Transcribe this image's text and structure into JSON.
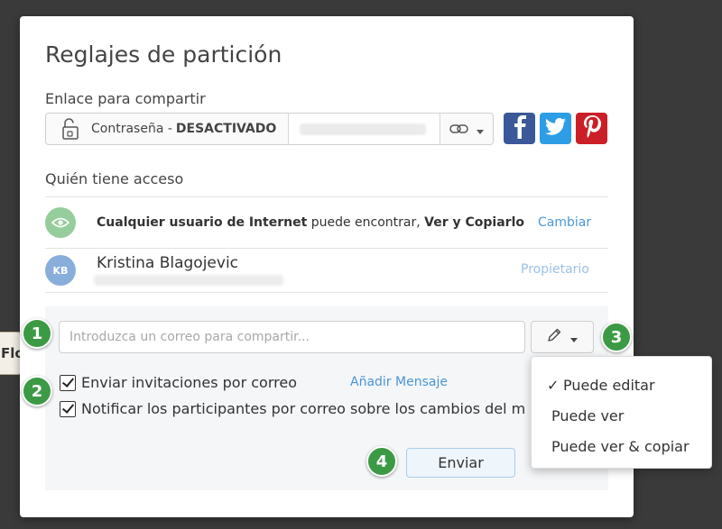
{
  "background": {
    "behind_tab_label": "Flo"
  },
  "dialog": {
    "title": "Reglajes de partición",
    "share_link": {
      "label": "Enlace para compartir",
      "password_label": "Contraseña -",
      "password_state": "DESACTIVADO",
      "url_value": "",
      "link_options_icon": "link-icon"
    },
    "social": [
      {
        "name": "facebook-icon",
        "glyph": "f",
        "color": "#3b5998"
      },
      {
        "name": "twitter-icon",
        "glyph": "bird",
        "color": "#2d9de6"
      },
      {
        "name": "pinterest-icon",
        "glyph": "p",
        "color": "#cb1f27"
      }
    ],
    "access": {
      "label": "Quién tiene acceso",
      "rows": [
        {
          "icon": "eye-icon",
          "who": "Cualquier usuario de Internet",
          "middle": " puede encontrar, ",
          "perm": "Ver y Copiarlo",
          "action": "Cambiar"
        },
        {
          "initials": "KB",
          "name": "Kristina Blagojevic",
          "email": "",
          "role": "Propietario"
        }
      ]
    },
    "invite": {
      "email_placeholder": "Introduzca un correo para compartir...",
      "email_value": "",
      "perm_icon": "pencil-icon",
      "checkbox_send_invites": "Enviar invitaciones por correo",
      "checkbox_send_invites_checked": true,
      "add_message": "Añadir Mensaje",
      "checkbox_notify": "Notificar los participantes por correo sobre los cambios del m",
      "checkbox_notify_checked": true,
      "send_button": "Enviar"
    },
    "permission_menu": {
      "items": [
        {
          "label": "Puede editar",
          "selected": true,
          "mark": "✓"
        },
        {
          "label": "Puede ver",
          "selected": false,
          "mark": ""
        },
        {
          "label": "Puede ver & copiar",
          "selected": false,
          "mark": ""
        }
      ]
    }
  },
  "badges": [
    "1",
    "2",
    "3",
    "4"
  ],
  "colors": {
    "accent_link": "#4a97d6",
    "badge_green": "#3c9a45",
    "public_avatar": "#96cd9c",
    "user_avatar": "#8aaedb"
  }
}
